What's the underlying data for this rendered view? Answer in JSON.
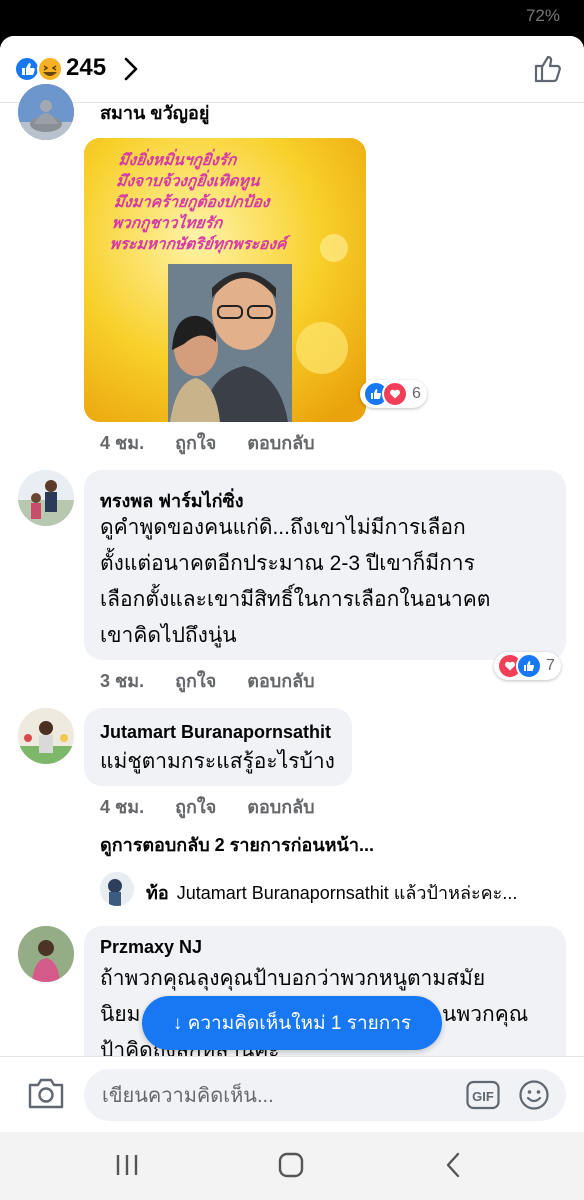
{
  "status_bar": {
    "battery": "72%"
  },
  "header": {
    "reaction_count": "245"
  },
  "comments": [
    {
      "name": "สมาน ขวัญอยู่",
      "image": {
        "poem_lines": [
          "มึงยิ่งหมิ่นฯกูยิ่งรัก",
          "มึงจาบจ้วงกูยิ่งเทิดทูน",
          "มึงมาคร้ายกูต้องปกป้อง",
          "พวกกูชาวไทยรัก",
          "พระมหากษัตริย์ทุกพระองค์"
        ]
      },
      "reactions": "6",
      "time": "4 ชม.",
      "like": "ถูกใจ",
      "reply": "ตอบกลับ"
    },
    {
      "name": "ทรงพล ฟาร์มไก่ซิ่ง",
      "text_lines": [
        "ดูคำพูดของคนแก่ดิ...ถึงเขาไม่มีการเลือก",
        "ตั้งแต่อนาคตอีกประมาณ 2-3 ปีเขาก็มีการ",
        "เลือกตั้งและเขามีสิทธิ์ในการเลือกในอนาคต",
        "เขาคิดไปถึงนู่น"
      ],
      "reactions": "7",
      "time": "3 ชม.",
      "like": "ถูกใจ",
      "reply": "ตอบกลับ"
    },
    {
      "name": "Jutamart Buranapornsathit",
      "text_lines": [
        "แม่ชูตามกระแสรู้อะไรบ้าง"
      ],
      "time": "4 ชม.",
      "like": "ถูกใจ",
      "reply": "ตอบกลับ",
      "previous_replies": "ดูการตอบกลับ 2 รายการก่อนหน้า...",
      "latest_reply": {
        "author": "ท้อ",
        "text": "Jutamart Buranapornsathit แล้วป้าหล่ะคะ..."
      }
    },
    {
      "name": "Przmaxy NJ",
      "text_lines": [
        "ถ้าพวกคุณลุงคุณป้าบอกว่าพวกหนูตามสมัย",
        "นิยม",
        "นพวกคุณ",
        "ป้าคิดถึงลูกหลานคะ"
      ]
    }
  ],
  "new_comments_pill": "↓ ความคิดเห็นใหม่ 1 รายการ",
  "composer": {
    "placeholder": "เขียนความคิดเห็น...",
    "gif_label": "GIF"
  },
  "colors": {
    "fb_blue": "#1877f2",
    "love_red": "#f33e58",
    "bubble_gray": "#f0f2f5",
    "meta_gray": "#65676b"
  }
}
